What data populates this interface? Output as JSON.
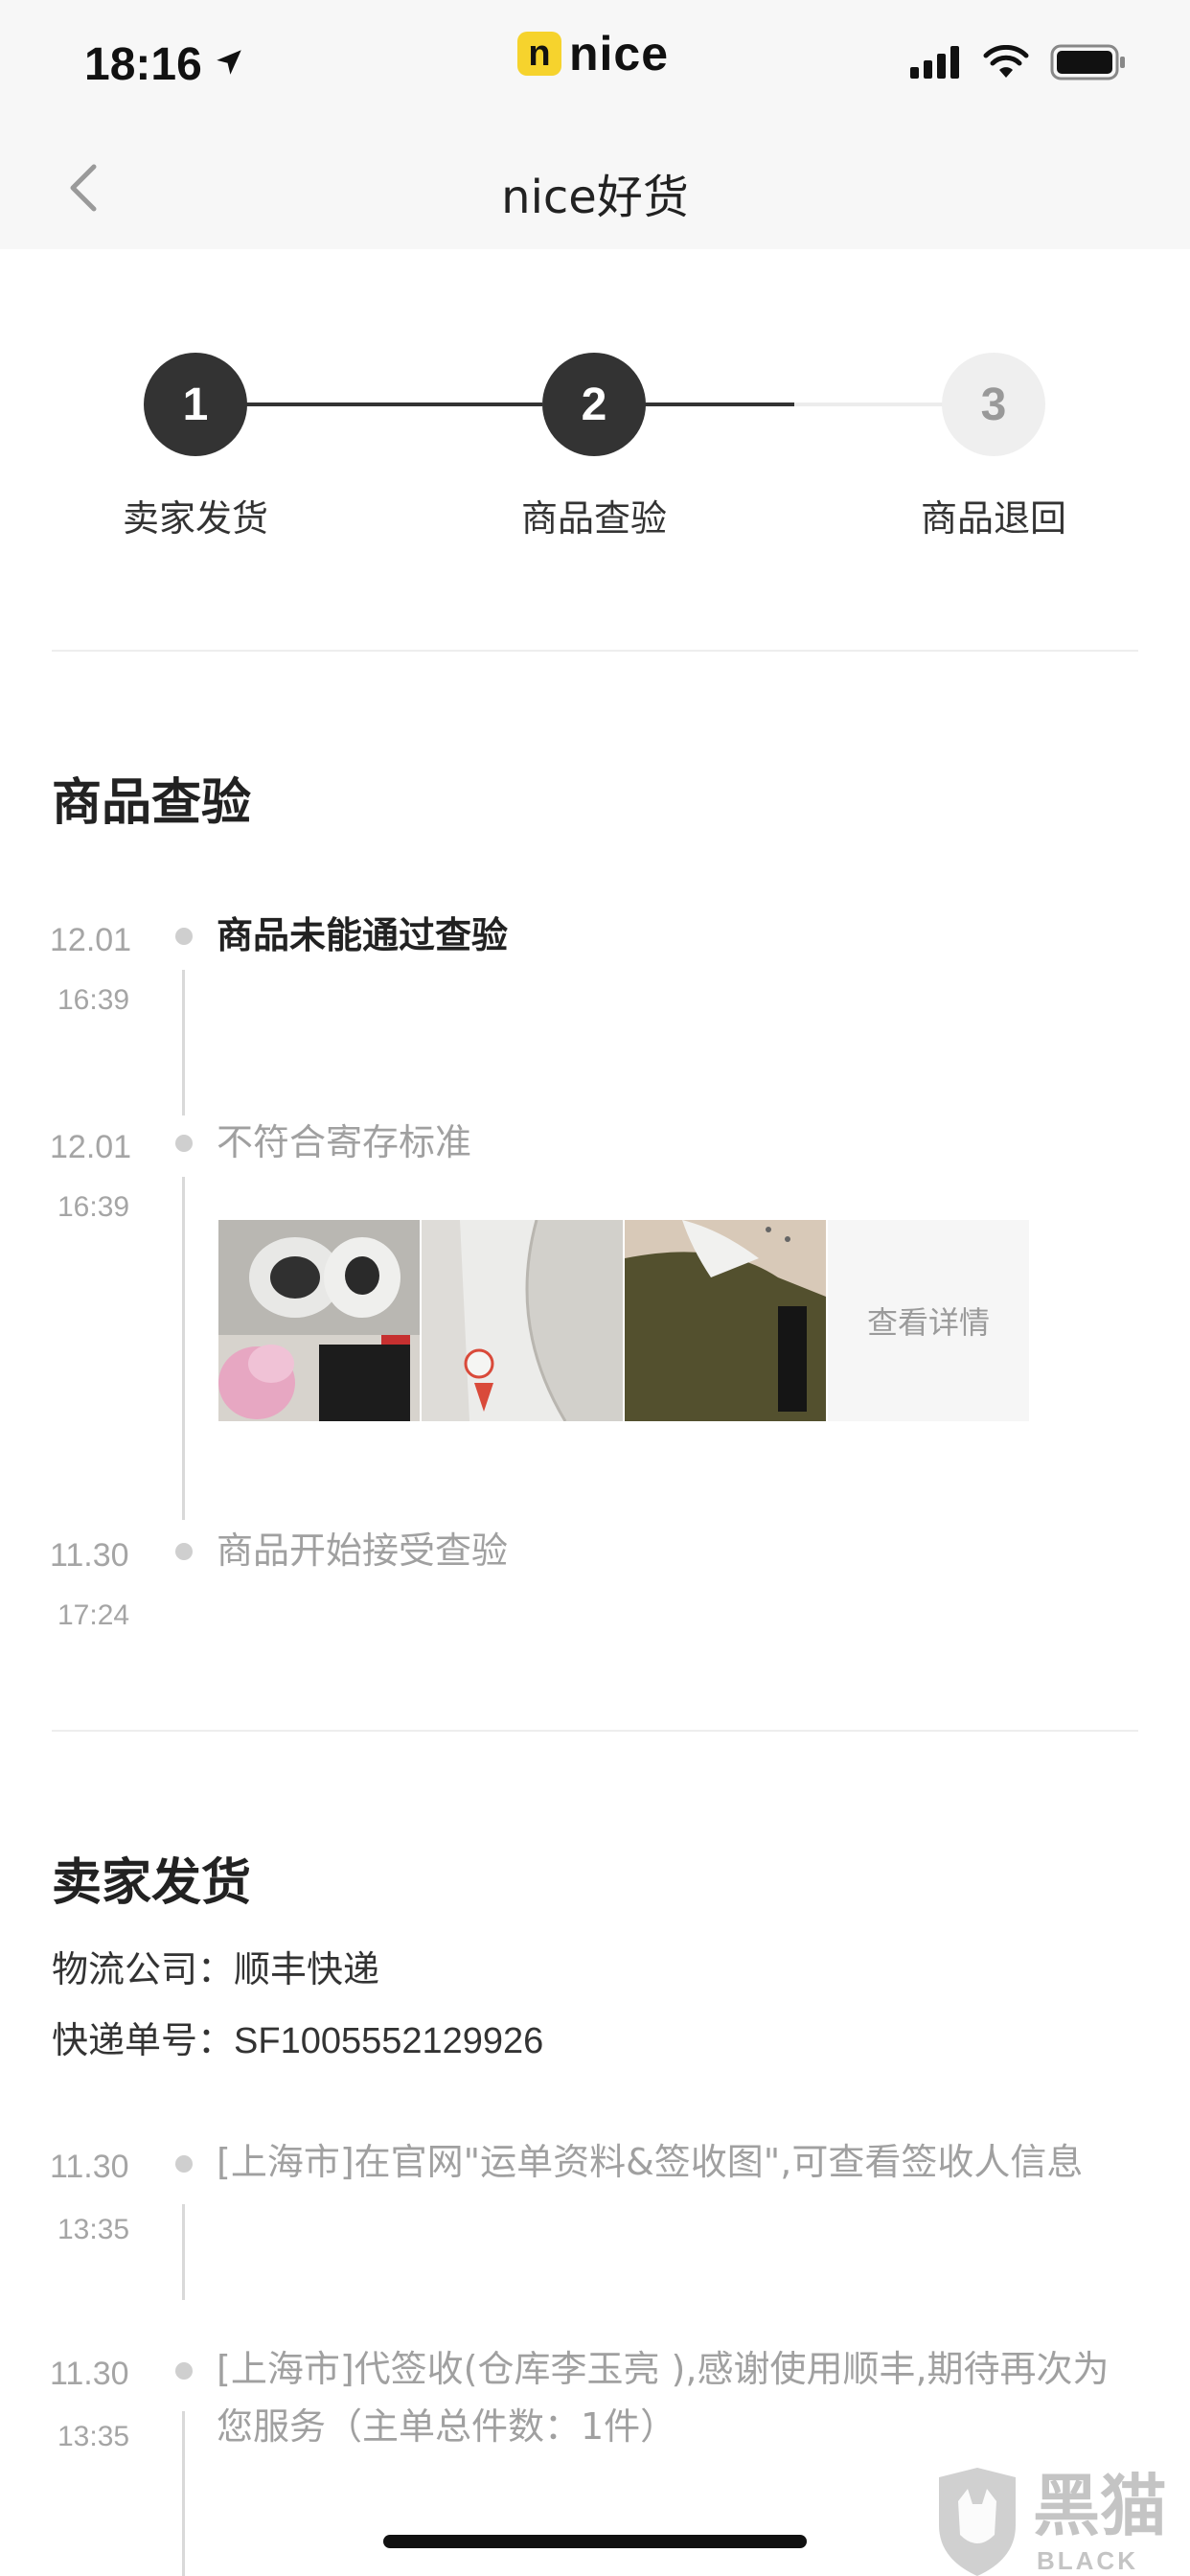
{
  "status_bar": {
    "time": "18:16",
    "brand_letter": "n",
    "brand_name": "nice"
  },
  "nav": {
    "title": "nice好货"
  },
  "steps": [
    {
      "number": "1",
      "label": "卖家发货",
      "state": "done"
    },
    {
      "number": "2",
      "label": "商品查验",
      "state": "done"
    },
    {
      "number": "3",
      "label": "商品退回",
      "state": "pending"
    }
  ],
  "inspection": {
    "title": "商品查验",
    "events": [
      {
        "date": "12.01",
        "time": "16:39",
        "text": "商品未能通过查验"
      },
      {
        "date": "12.01",
        "time": "16:39",
        "text": "不符合寄存标准",
        "detail_label": "查看详情"
      },
      {
        "date": "11.30",
        "time": "17:24",
        "text": "商品开始接受查验"
      }
    ]
  },
  "shipping": {
    "title": "卖家发货",
    "company_label": "物流公司：",
    "company_value": "顺丰快递",
    "tracking_label": "快递单号：",
    "tracking_value": "SF1005552129926",
    "events": [
      {
        "date": "11.30",
        "time": "13:35",
        "text": "[上海市]在官网\"运单资料&签收图\",可查看签收人信息"
      },
      {
        "date": "11.30",
        "time": "13:35",
        "text_line1": "[上海市]代签收(仓库李玉亮 ),感谢使用顺丰,期待再次为",
        "text_line2": "您服务（主单总件数：1件）"
      }
    ]
  },
  "watermark": {
    "cn": "黑猫",
    "en": "BLACK CAT"
  },
  "colors": {
    "dark": "#333333",
    "muted": "#a0a0a0",
    "brand_yellow": "#f6d32d"
  }
}
